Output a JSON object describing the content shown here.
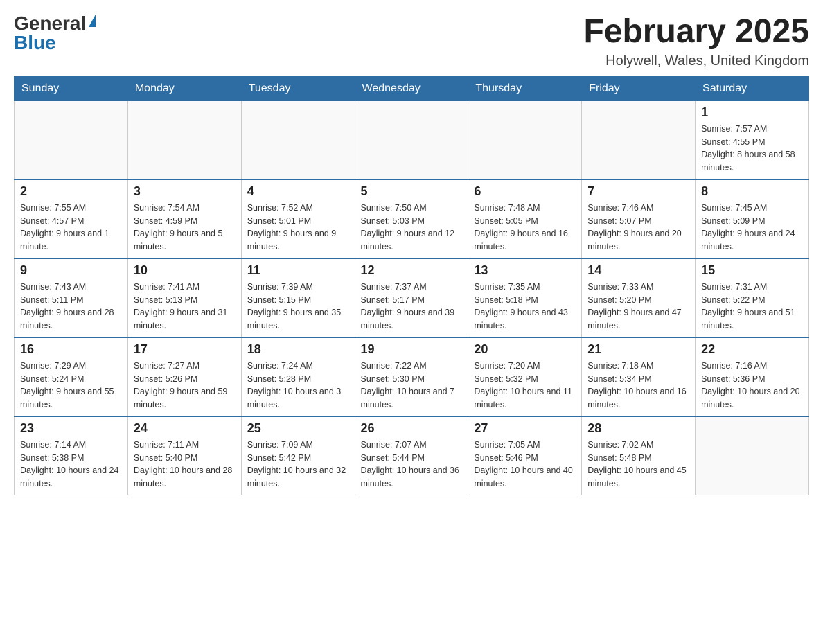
{
  "logo": {
    "general": "General",
    "blue": "Blue"
  },
  "title": "February 2025",
  "location": "Holywell, Wales, United Kingdom",
  "days_of_week": [
    "Sunday",
    "Monday",
    "Tuesday",
    "Wednesday",
    "Thursday",
    "Friday",
    "Saturday"
  ],
  "weeks": [
    [
      {
        "day": "",
        "info": ""
      },
      {
        "day": "",
        "info": ""
      },
      {
        "day": "",
        "info": ""
      },
      {
        "day": "",
        "info": ""
      },
      {
        "day": "",
        "info": ""
      },
      {
        "day": "",
        "info": ""
      },
      {
        "day": "1",
        "info": "Sunrise: 7:57 AM\nSunset: 4:55 PM\nDaylight: 8 hours and 58 minutes."
      }
    ],
    [
      {
        "day": "2",
        "info": "Sunrise: 7:55 AM\nSunset: 4:57 PM\nDaylight: 9 hours and 1 minute."
      },
      {
        "day": "3",
        "info": "Sunrise: 7:54 AM\nSunset: 4:59 PM\nDaylight: 9 hours and 5 minutes."
      },
      {
        "day": "4",
        "info": "Sunrise: 7:52 AM\nSunset: 5:01 PM\nDaylight: 9 hours and 9 minutes."
      },
      {
        "day": "5",
        "info": "Sunrise: 7:50 AM\nSunset: 5:03 PM\nDaylight: 9 hours and 12 minutes."
      },
      {
        "day": "6",
        "info": "Sunrise: 7:48 AM\nSunset: 5:05 PM\nDaylight: 9 hours and 16 minutes."
      },
      {
        "day": "7",
        "info": "Sunrise: 7:46 AM\nSunset: 5:07 PM\nDaylight: 9 hours and 20 minutes."
      },
      {
        "day": "8",
        "info": "Sunrise: 7:45 AM\nSunset: 5:09 PM\nDaylight: 9 hours and 24 minutes."
      }
    ],
    [
      {
        "day": "9",
        "info": "Sunrise: 7:43 AM\nSunset: 5:11 PM\nDaylight: 9 hours and 28 minutes."
      },
      {
        "day": "10",
        "info": "Sunrise: 7:41 AM\nSunset: 5:13 PM\nDaylight: 9 hours and 31 minutes."
      },
      {
        "day": "11",
        "info": "Sunrise: 7:39 AM\nSunset: 5:15 PM\nDaylight: 9 hours and 35 minutes."
      },
      {
        "day": "12",
        "info": "Sunrise: 7:37 AM\nSunset: 5:17 PM\nDaylight: 9 hours and 39 minutes."
      },
      {
        "day": "13",
        "info": "Sunrise: 7:35 AM\nSunset: 5:18 PM\nDaylight: 9 hours and 43 minutes."
      },
      {
        "day": "14",
        "info": "Sunrise: 7:33 AM\nSunset: 5:20 PM\nDaylight: 9 hours and 47 minutes."
      },
      {
        "day": "15",
        "info": "Sunrise: 7:31 AM\nSunset: 5:22 PM\nDaylight: 9 hours and 51 minutes."
      }
    ],
    [
      {
        "day": "16",
        "info": "Sunrise: 7:29 AM\nSunset: 5:24 PM\nDaylight: 9 hours and 55 minutes."
      },
      {
        "day": "17",
        "info": "Sunrise: 7:27 AM\nSunset: 5:26 PM\nDaylight: 9 hours and 59 minutes."
      },
      {
        "day": "18",
        "info": "Sunrise: 7:24 AM\nSunset: 5:28 PM\nDaylight: 10 hours and 3 minutes."
      },
      {
        "day": "19",
        "info": "Sunrise: 7:22 AM\nSunset: 5:30 PM\nDaylight: 10 hours and 7 minutes."
      },
      {
        "day": "20",
        "info": "Sunrise: 7:20 AM\nSunset: 5:32 PM\nDaylight: 10 hours and 11 minutes."
      },
      {
        "day": "21",
        "info": "Sunrise: 7:18 AM\nSunset: 5:34 PM\nDaylight: 10 hours and 16 minutes."
      },
      {
        "day": "22",
        "info": "Sunrise: 7:16 AM\nSunset: 5:36 PM\nDaylight: 10 hours and 20 minutes."
      }
    ],
    [
      {
        "day": "23",
        "info": "Sunrise: 7:14 AM\nSunset: 5:38 PM\nDaylight: 10 hours and 24 minutes."
      },
      {
        "day": "24",
        "info": "Sunrise: 7:11 AM\nSunset: 5:40 PM\nDaylight: 10 hours and 28 minutes."
      },
      {
        "day": "25",
        "info": "Sunrise: 7:09 AM\nSunset: 5:42 PM\nDaylight: 10 hours and 32 minutes."
      },
      {
        "day": "26",
        "info": "Sunrise: 7:07 AM\nSunset: 5:44 PM\nDaylight: 10 hours and 36 minutes."
      },
      {
        "day": "27",
        "info": "Sunrise: 7:05 AM\nSunset: 5:46 PM\nDaylight: 10 hours and 40 minutes."
      },
      {
        "day": "28",
        "info": "Sunrise: 7:02 AM\nSunset: 5:48 PM\nDaylight: 10 hours and 45 minutes."
      },
      {
        "day": "",
        "info": ""
      }
    ]
  ]
}
